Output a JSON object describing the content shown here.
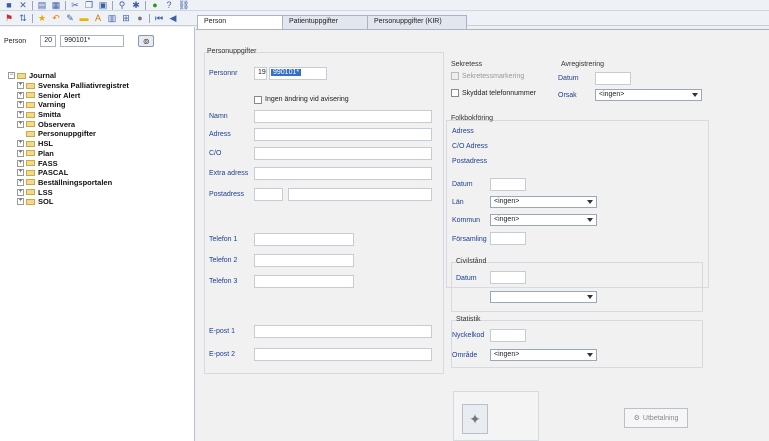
{
  "person_bar": {
    "label": "Person",
    "number": "20",
    "id": "990101*"
  },
  "tree": [
    {
      "label": "Journal",
      "expanded": true,
      "level": 0
    },
    {
      "label": "Svenska Palliativregistret",
      "level": 1,
      "expandable": true
    },
    {
      "label": "Senior Alert",
      "level": 1,
      "expandable": true
    },
    {
      "label": "Varning",
      "level": 1,
      "expandable": true
    },
    {
      "label": "Smitta",
      "level": 1,
      "expandable": true
    },
    {
      "label": "Observera",
      "level": 1,
      "expandable": true
    },
    {
      "label": "Personuppgifter",
      "level": 1,
      "expandable": false
    },
    {
      "label": "HSL",
      "level": 1,
      "expandable": true
    },
    {
      "label": "Plan",
      "level": 1,
      "expandable": true
    },
    {
      "label": "FASS",
      "level": 1,
      "expandable": true
    },
    {
      "label": "PASCAL",
      "level": 1,
      "expandable": true
    },
    {
      "label": "Beställningsportalen",
      "level": 1,
      "expandable": true
    },
    {
      "label": "LSS",
      "level": 1,
      "expandable": true
    },
    {
      "label": "SOL",
      "level": 1,
      "expandable": true
    }
  ],
  "tabs": [
    {
      "label": "Person",
      "active": true
    },
    {
      "label": "Patientuppgifter",
      "active": false
    },
    {
      "label": "Personuppgifter (KIR)",
      "active": false
    }
  ],
  "personuppgifter": {
    "title": "Personuppgifter",
    "personnr_label": "Personnr",
    "personnr_century": "19",
    "personnr_value": "990101*",
    "ingen_andring_label": "Ingen ändring vid avisering",
    "namn_label": "Namn",
    "adress_label": "Adress",
    "co_label": "C/O",
    "extra_adress_label": "Extra adress",
    "postadress_label": "Postadress",
    "telefon1_label": "Telefon 1",
    "telefon2_label": "Telefon 2",
    "telefon3_label": "Telefon 3",
    "epost1_label": "E-post 1",
    "epost2_label": "E-post 2"
  },
  "sekretess": {
    "title": "Sekretess",
    "markering_label": "Sekretessmarkering",
    "skyddat_label": "Skyddat telefonnummer"
  },
  "avregistrering": {
    "title": "Avregistrering",
    "datum_label": "Datum",
    "orsak_label": "Orsak",
    "orsak_value": "<ingen>"
  },
  "folkbokforing": {
    "title": "Folkbokföring",
    "adress_label": "Adress",
    "co_adress_label": "C/O Adress",
    "postadress_label": "Postadress",
    "datum_label": "Datum",
    "lan_label": "Län",
    "lan_value": "<ingen>",
    "kommun_label": "Kommun",
    "kommun_value": "<ingen>",
    "forsamling_label": "Församling"
  },
  "civilstand": {
    "title": "Civilstånd",
    "datum_label": "Datum",
    "value": ""
  },
  "statistik": {
    "title": "Statistik",
    "nyckelkod_label": "Nyckelkod",
    "omrade_label": "Område",
    "omrade_value": "<ingen>"
  },
  "buttons": {
    "utbetalning_label": "Utbetalning"
  }
}
